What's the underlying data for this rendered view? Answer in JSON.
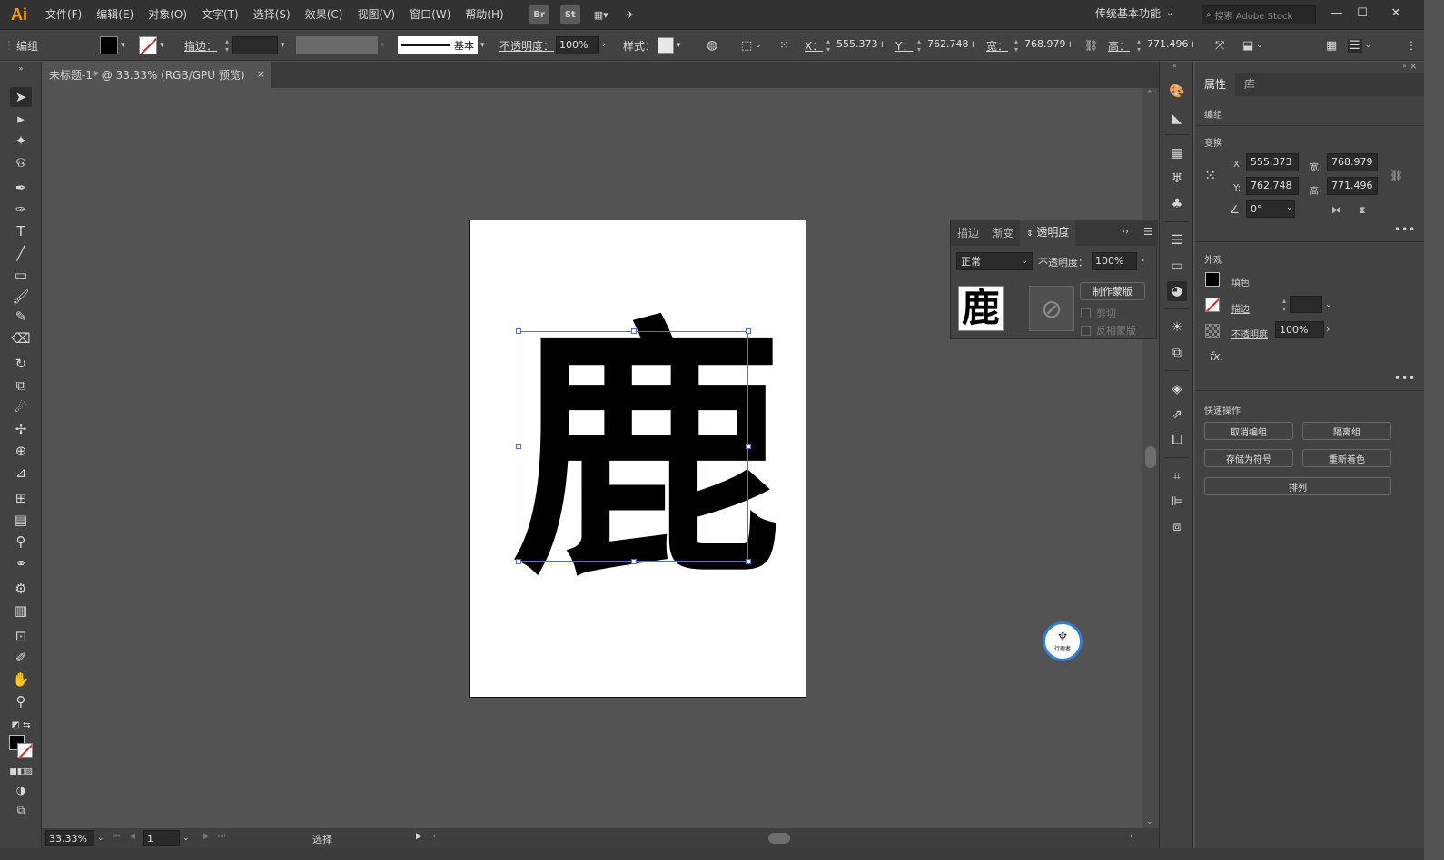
{
  "app": {
    "logo": "Ai",
    "menu": [
      "文件(F)",
      "编辑(E)",
      "对象(O)",
      "文字(T)",
      "选择(S)",
      "效果(C)",
      "视图(V)",
      "窗口(W)",
      "帮助(H)"
    ],
    "bridge_label": "Br",
    "stock_label": "St",
    "workspace": "传统基本功能",
    "stock_search_placeholder": "搜索 Adobe Stock",
    "window_controls": [
      "—",
      "☐",
      "✕"
    ]
  },
  "controlbar": {
    "object_type": "编组",
    "fill_color": "#000000",
    "stroke_label": "描边：",
    "stroke_style": "基本",
    "opacity_label": "不透明度：",
    "opacity_value": "100%",
    "style_label": "样式：",
    "x_label": "X：",
    "x_value": "555.373",
    "y_label": "Y：",
    "y_value": "762.748",
    "w_label": "宽：",
    "w_value": "768.979",
    "h_label": "高：",
    "h_value": "771.496",
    "unit": "I"
  },
  "document": {
    "tab_title": "未标题-1* @ 33.33% (RGB/GPU 预览)",
    "close": "×",
    "glyph": "鹿"
  },
  "watermark": {
    "text": "行鹿者"
  },
  "statusbar": {
    "zoom": "33.33%",
    "page": "1",
    "tool_status": "选择"
  },
  "transparency_panel": {
    "tabs": [
      "描边",
      "渐变",
      "透明度"
    ],
    "active_tab": "透明度",
    "blend_mode": "正常",
    "opacity_label": "不透明度：",
    "opacity_value": "100%",
    "thumb_glyph": "鹿",
    "make_mask": "制作蒙版",
    "clip": "剪切",
    "invert_mask": "反相蒙版"
  },
  "properties": {
    "tabs": [
      "属性",
      "库"
    ],
    "active_tab": "属性",
    "object_type": "编组",
    "transform_title": "变换",
    "x_label": "X:",
    "x_value": "555.373",
    "y_label": "Y:",
    "y_value": "762.748",
    "w_label": "宽:",
    "w_value": "768.979",
    "h_label": "高:",
    "h_value": "771.496",
    "angle_value": "0°",
    "appearance_title": "外观",
    "fill_label": "填色",
    "stroke_label": "描边",
    "opacity_label": "不透明度",
    "opacity_value": "100%",
    "fx": "fx.",
    "quick_actions_title": "快速操作",
    "btn_ungroup": "取消编组",
    "btn_isolate": "隔离组",
    "btn_save_symbol": "存储为符号",
    "btn_recolor": "重新着色",
    "btn_arrange": "排列"
  },
  "colors": {
    "accent_selection": "#4a6cf7",
    "logo": "#ff9a00",
    "ui_dark": "#323232",
    "ui_panel": "#424242",
    "canvas": "#535353"
  }
}
